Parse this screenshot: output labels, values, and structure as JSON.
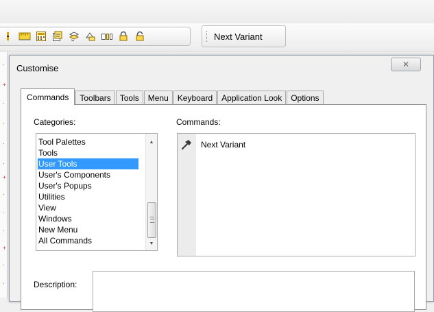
{
  "toolbar": {
    "icons": [
      "divider-grip-icon",
      "ruler-icon",
      "calculator-icon",
      "property-icon",
      "layers-icon",
      "compare-icon",
      "columns-icon",
      "lock-closed-icon",
      "lock-open-icon"
    ],
    "next_variant_label": "Next Variant"
  },
  "dialog": {
    "title": "Customise",
    "close_glyph": "✕",
    "tabs": [
      "Commands",
      "Toolbars",
      "Tools",
      "Menu",
      "Keyboard",
      "Application Look",
      "Options"
    ],
    "active_tab": "Commands",
    "categories_label": "Categories:",
    "commands_label": "Commands:",
    "categories": [
      "Tool Palettes",
      "Tools",
      "User Tools",
      "User's Components",
      "User's Popups",
      "Utilities",
      "View",
      "Windows",
      "New Menu",
      "All Commands"
    ],
    "selected_category": "User Tools",
    "commands": [
      {
        "label": "Next Variant",
        "icon": "hammer-icon"
      }
    ],
    "description_label": "Description:",
    "description_value": ""
  },
  "colors": {
    "selection": "#3399ff",
    "marker_red": "#d02020"
  }
}
